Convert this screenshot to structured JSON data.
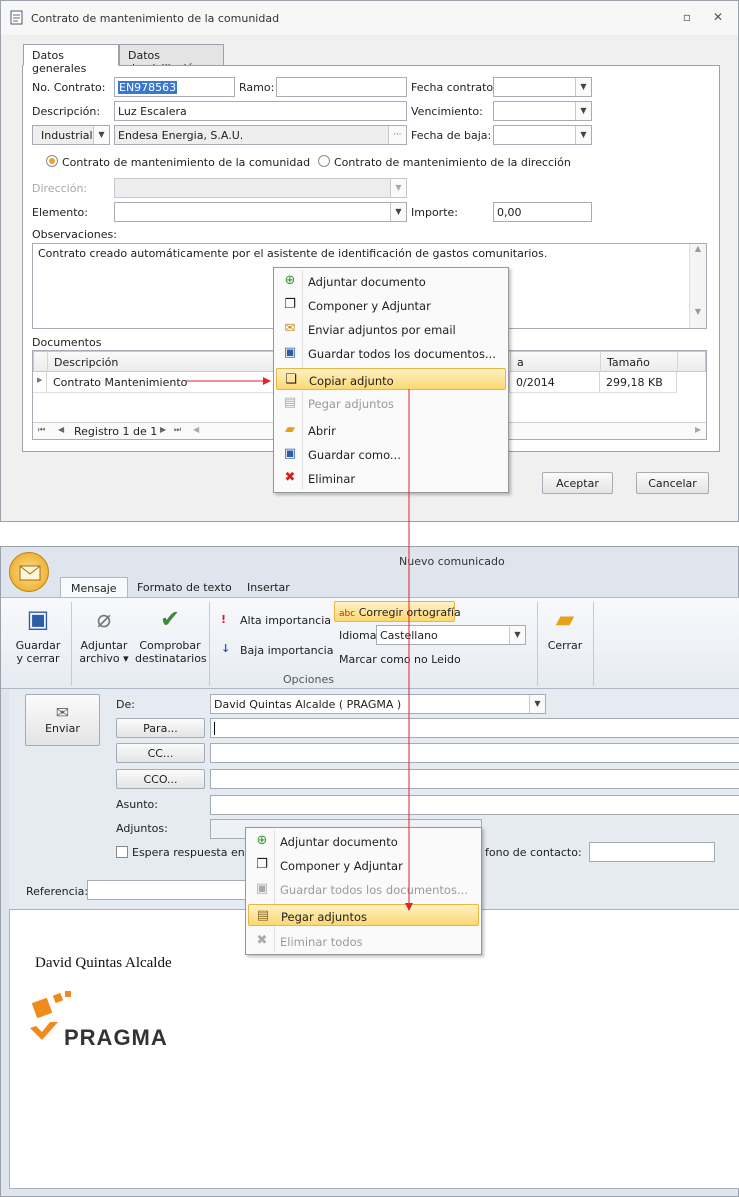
{
  "window1": {
    "title": "Contrato de mantenimiento de la comunidad",
    "tabs": [
      "Datos generales",
      "Datos domiciliación"
    ],
    "fields": {
      "no_contrato_label": "No. Contrato:",
      "no_contrato_value": "EN978563",
      "ramo_label": "Ramo:",
      "ramo_value": "",
      "fecha_contrato_label": "Fecha contrato:",
      "descripcion_label": "Descripción:",
      "descripcion_value": "Luz Escalera",
      "vencimiento_label": "Vencimiento:",
      "tipo_value": "Industrial",
      "proveedor_value": "Endesa Energia, S.A.U.",
      "proveedor_button": "···",
      "fecha_baja_label": "Fecha de baja:",
      "radio_comunidad": "Contrato de mantenimiento de la comunidad",
      "radio_direccion": "Contrato de mantenimiento de la dirección",
      "direccion_label": "Dirección:",
      "elemento_label": "Elemento:",
      "importe_label": "Importe:",
      "importe_value": "0,00",
      "observaciones_label": "Observaciones:",
      "observaciones_value": "Contrato creado automáticamente por el asistente de identificación de gastos comunitarios."
    },
    "documentos": {
      "label": "Documentos",
      "columns": [
        "Descripción",
        "a",
        "Tamaño"
      ],
      "rows": [
        {
          "descripcion": "Contrato Mantenimiento",
          "fecha": "0/2014",
          "tamano": "299,18 KB"
        }
      ],
      "navigator": "Registro 1 de 1"
    },
    "buttons": {
      "accept": "Aceptar",
      "cancel": "Cancelar"
    },
    "context_menu": [
      {
        "label": "Adjuntar documento",
        "icon": "attach-doc-icon",
        "state": "normal"
      },
      {
        "label": "Componer y Adjuntar",
        "icon": "compose-icon",
        "state": "normal"
      },
      {
        "label": "Enviar adjuntos por email",
        "icon": "email-attach-icon",
        "state": "normal"
      },
      {
        "label": "Guardar todos los documentos...",
        "icon": "save-all-icon",
        "state": "normal"
      },
      {
        "label": "Copiar adjunto",
        "icon": "copy-icon",
        "state": "highlighted"
      },
      {
        "label": "Pegar adjuntos",
        "icon": "paste-icon",
        "state": "disabled"
      },
      {
        "label": "Abrir",
        "icon": "folder-open-icon",
        "state": "normal"
      },
      {
        "label": "Guardar como...",
        "icon": "save-icon",
        "state": "normal"
      },
      {
        "label": "Eliminar",
        "icon": "delete-icon",
        "state": "normal"
      }
    ]
  },
  "window2": {
    "title": "Nuevo comunicado",
    "tabs": [
      "Mensaje",
      "Formato de texto",
      "Insertar"
    ],
    "ribbon": {
      "save_close": [
        "Guardar",
        "y cerrar"
      ],
      "attach": [
        "Adjuntar",
        "archivo"
      ],
      "check": [
        "Comprobar",
        "destinatarios"
      ],
      "high_importance": "Alta importancia",
      "low_importance": "Baja importancia",
      "spell": "Corregir ortografía",
      "language_label": "Idioma:",
      "language_value": "Castellano",
      "mark_unread": "Marcar como no Leido",
      "group_label": "Opciones",
      "close": "Cerrar"
    },
    "form": {
      "send": "Enviar",
      "de_label": "De:",
      "de_value": "David Quintas Alcalde ( PRAGMA )",
      "para": "Para...",
      "cc": "CC...",
      "cco": "CCO...",
      "asunto_label": "Asunto:",
      "adjuntos_label": "Adjuntos:",
      "espera_label": "Espera respuesta en:",
      "telefono_label": "fono de contacto:",
      "referencia_label": "Referencia:"
    },
    "signature_name": "David Quintas Alcalde",
    "logo_text": "PRAGMA",
    "context_menu": [
      {
        "label": "Adjuntar documento",
        "icon": "attach-doc-icon",
        "state": "normal"
      },
      {
        "label": "Componer y Adjuntar",
        "icon": "compose-icon",
        "state": "normal"
      },
      {
        "label": "Guardar todos los documentos...",
        "icon": "save-all-icon",
        "state": "disabled"
      },
      {
        "label": "Pegar adjuntos",
        "icon": "paste-icon",
        "state": "highlighted"
      },
      {
        "label": "Eliminar todos",
        "icon": "delete-all-icon",
        "state": "disabled"
      }
    ]
  },
  "colors": {
    "arrow": "#e0242a",
    "highlight": "#fbd872",
    "selection": "#3a78d0",
    "logo_orange": "#f08a1c"
  }
}
